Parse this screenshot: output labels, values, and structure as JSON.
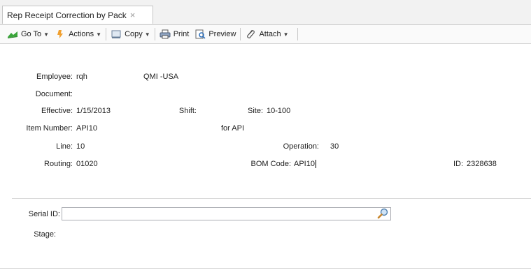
{
  "tab": {
    "title": "Rep Receipt Correction by Pack",
    "close": "×"
  },
  "toolbar": {
    "goto": "Go To",
    "actions": "Actions",
    "copy": "Copy",
    "print": "Print",
    "preview": "Preview",
    "attach": "Attach"
  },
  "form": {
    "employee_label": "Employee:",
    "employee_value": "rqh",
    "company_value": "QMI -USA",
    "document_label": "Document:",
    "effective_label": "Effective:",
    "effective_value": "1/15/2013",
    "shift_label": "Shift:",
    "site_label": "Site:",
    "site_value": "10-100",
    "item_label": "Item Number:",
    "item_value": "API10",
    "item_desc": "for API",
    "line_label": "Line:",
    "line_value": "10",
    "operation_label": "Operation:",
    "operation_value": "30",
    "routing_label": "Routing:",
    "routing_value": "01020",
    "bom_label": "BOM Code:",
    "bom_value": "API10",
    "id_label": "ID:",
    "id_value": "2328638",
    "serial_label": "Serial ID:",
    "serial_value": "",
    "stage_label": "Stage:"
  },
  "colors": {
    "accent_green": "#3aa63a",
    "accent_orange": "#f0a030"
  },
  "icons": [
    "goto-icon",
    "actions-icon",
    "copy-icon",
    "print-icon",
    "preview-icon",
    "attach-icon",
    "search-icon"
  ]
}
